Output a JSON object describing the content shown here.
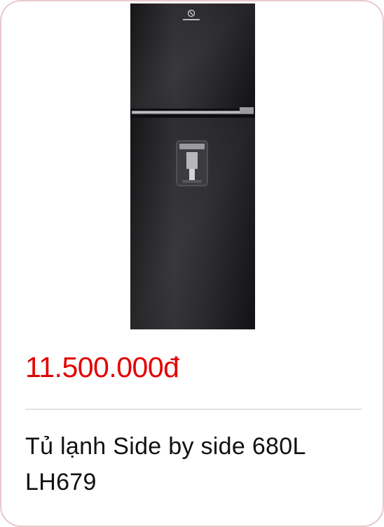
{
  "product": {
    "image_alt": "Electrolux refrigerator",
    "brand_logo_text": "Electrolux",
    "price": "11.500.000đ",
    "title": "Tủ lạnh Side by side 680L LH679"
  },
  "colors": {
    "card_border": "#e9c9cc",
    "price": "#e30000",
    "divider": "#e3e3e3",
    "title": "#111111",
    "fridge_body": "#1c1c1e"
  },
  "icons": {
    "logo": "electrolux-logo-icon",
    "dispenser": "water-dispenser-icon"
  }
}
